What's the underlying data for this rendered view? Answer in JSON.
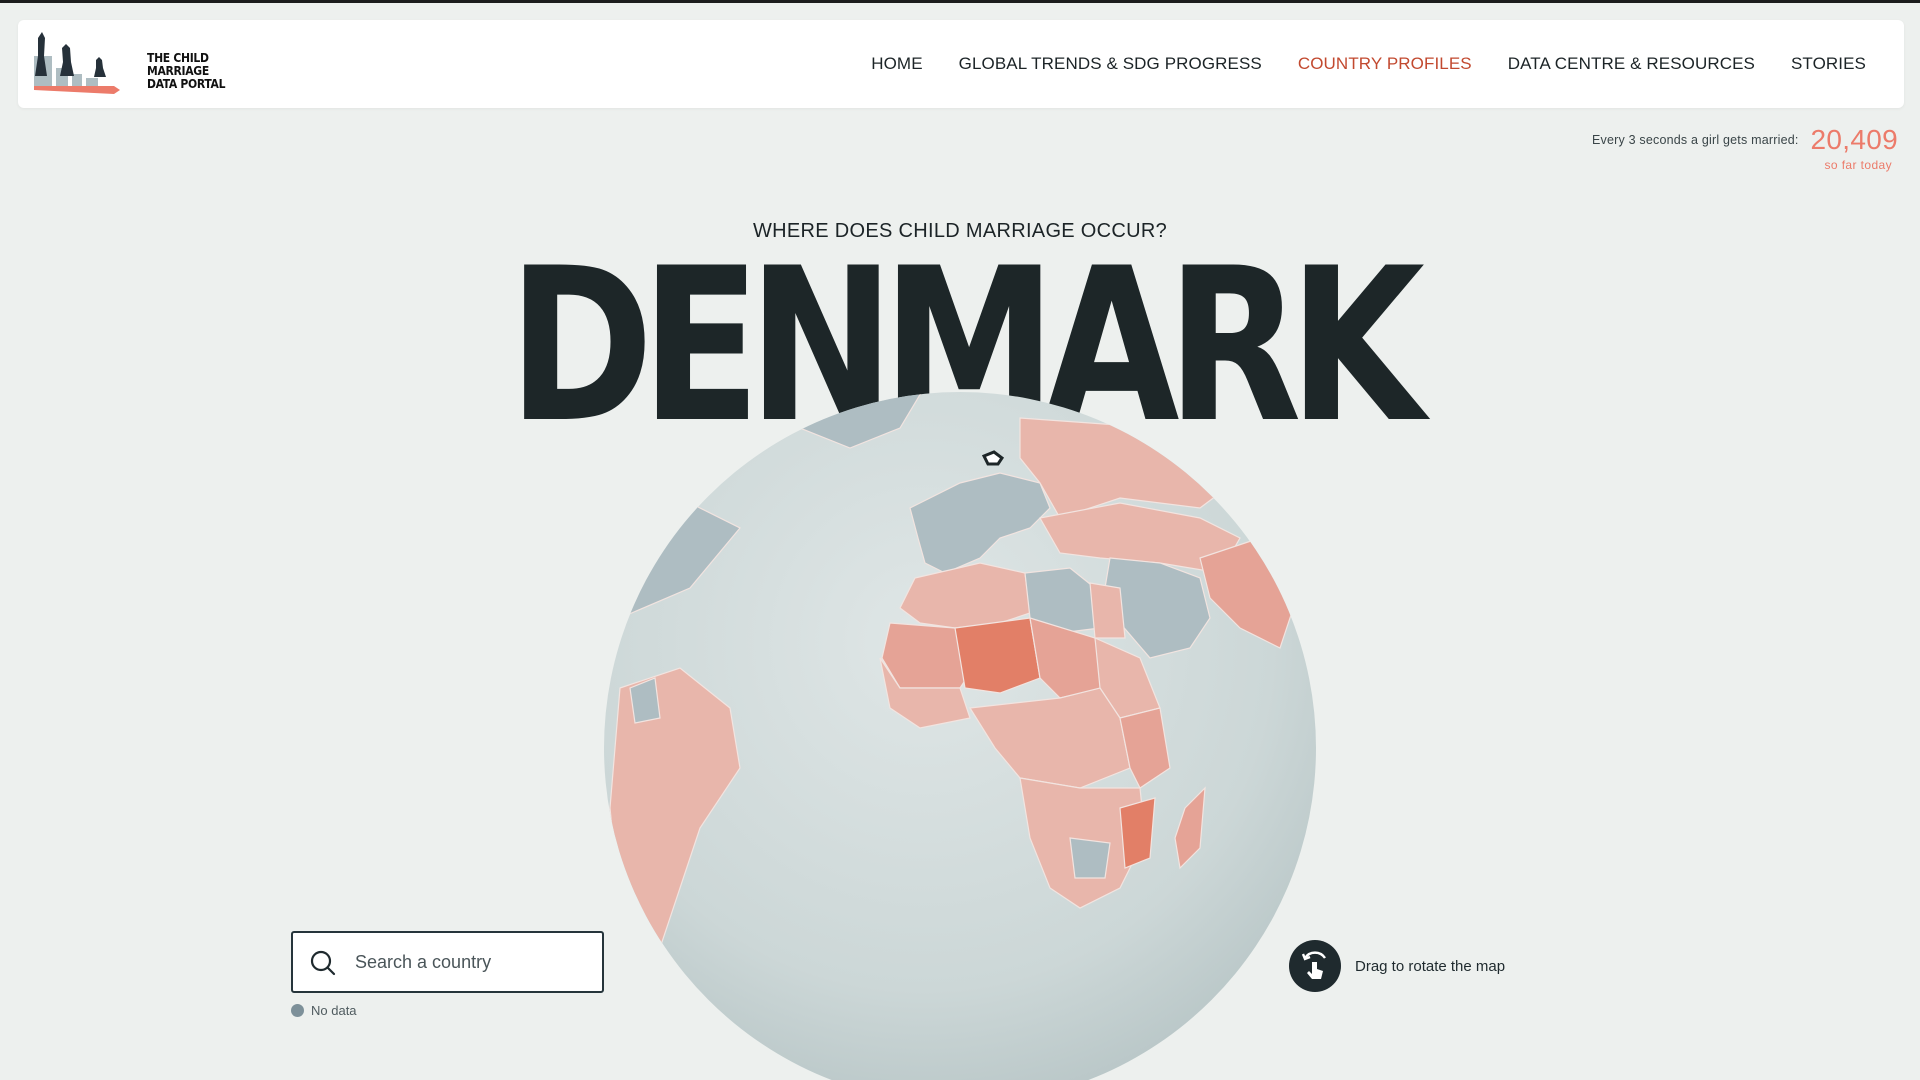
{
  "header": {
    "logo_text": "THE CHILD MARRIAGE DATA PORTAL",
    "nav": [
      {
        "label": "HOME",
        "active": false
      },
      {
        "label": "GLOBAL TRENDS & SDG PROGRESS",
        "active": false
      },
      {
        "label": "COUNTRY PROFILES",
        "active": true
      },
      {
        "label": "DATA CENTRE & RESOURCES",
        "active": false
      },
      {
        "label": "STORIES",
        "active": false
      }
    ]
  },
  "counter": {
    "label": "Every 3 seconds a girl gets married:",
    "value": "20,409",
    "sub": "so far today"
  },
  "main": {
    "question": "WHERE DOES CHILD MARRIAGE OCCUR?",
    "country": "DENMARK"
  },
  "search": {
    "placeholder": "Search a country",
    "value": ""
  },
  "legend": {
    "no_data_label": "No data"
  },
  "drag_hint": {
    "label": "Drag to rotate the map"
  },
  "colors": {
    "accent": "#c2492f",
    "counter": "#ec7b6a",
    "no_data": "#7d9099",
    "globe_ocean": "#cfd9d9",
    "data_low": "#e8b6ab",
    "data_mid": "#e5a396",
    "data_high": "#e27f67",
    "no_data_land": "#aebdc2"
  },
  "icons": [
    "search-icon",
    "rotate-hand-icon"
  ]
}
